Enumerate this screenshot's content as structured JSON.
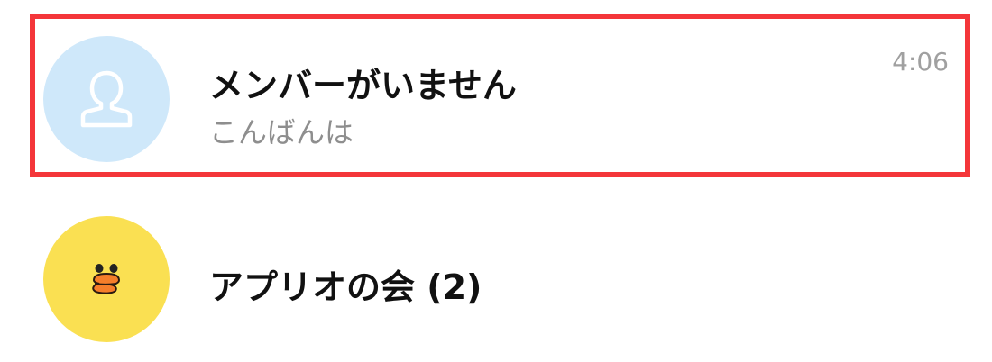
{
  "chats": [
    {
      "name": "メンバーがいません",
      "preview": "こんばんは",
      "time": "4:06",
      "avatar": "default-person-icon",
      "avatar_color": "#cfe8fa",
      "highlighted": true
    },
    {
      "name": "アプリオの会 (2)",
      "avatar": "sally-chick-icon",
      "avatar_color": "#fae052"
    }
  ],
  "colors": {
    "highlight_border": "#f4363a",
    "name_text": "#111111",
    "preview_text": "#8e8e8e",
    "time_text": "#a0a0a0"
  }
}
